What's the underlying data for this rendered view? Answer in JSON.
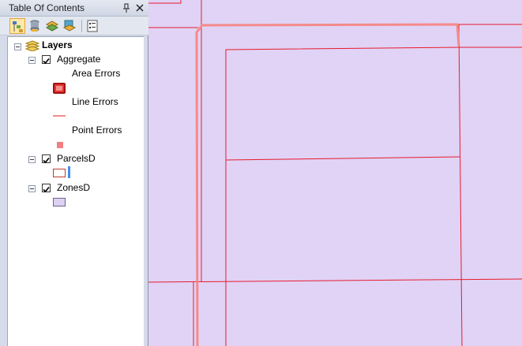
{
  "toc": {
    "title": "Table Of Contents",
    "pin_icon": "pin-icon",
    "close_icon": "close-icon",
    "toolbar": [
      {
        "name": "list-by-drawing-order-icon",
        "active": true
      },
      {
        "name": "list-by-source-icon",
        "active": false
      },
      {
        "name": "list-by-visibility-icon",
        "active": false
      },
      {
        "name": "list-by-selection-icon",
        "active": false
      },
      {
        "name": "options-icon",
        "active": false
      }
    ],
    "root": {
      "label": "Layers",
      "icon": "layers-icon"
    },
    "layers": [
      {
        "name": "Aggregate",
        "checked": true,
        "legend": [
          {
            "label": "Area Errors",
            "symbol": "area-symbol"
          },
          {
            "label": "Line Errors",
            "symbol": "line-symbol"
          },
          {
            "label": "Point Errors",
            "symbol": "point-symbol"
          }
        ]
      },
      {
        "name": "ParcelsD",
        "checked": true
      },
      {
        "name": "ZonesD",
        "checked": true
      }
    ]
  },
  "colors": {
    "map_fill": "#e0d3f6",
    "parcel_line": "#e81b2c",
    "error_line": "#f58a8a",
    "zone_fill": "#ddd1f3",
    "area_error_fill": "#e4342f",
    "point_error_fill": "#f08080",
    "selection_bar": "#3d8ef0"
  }
}
